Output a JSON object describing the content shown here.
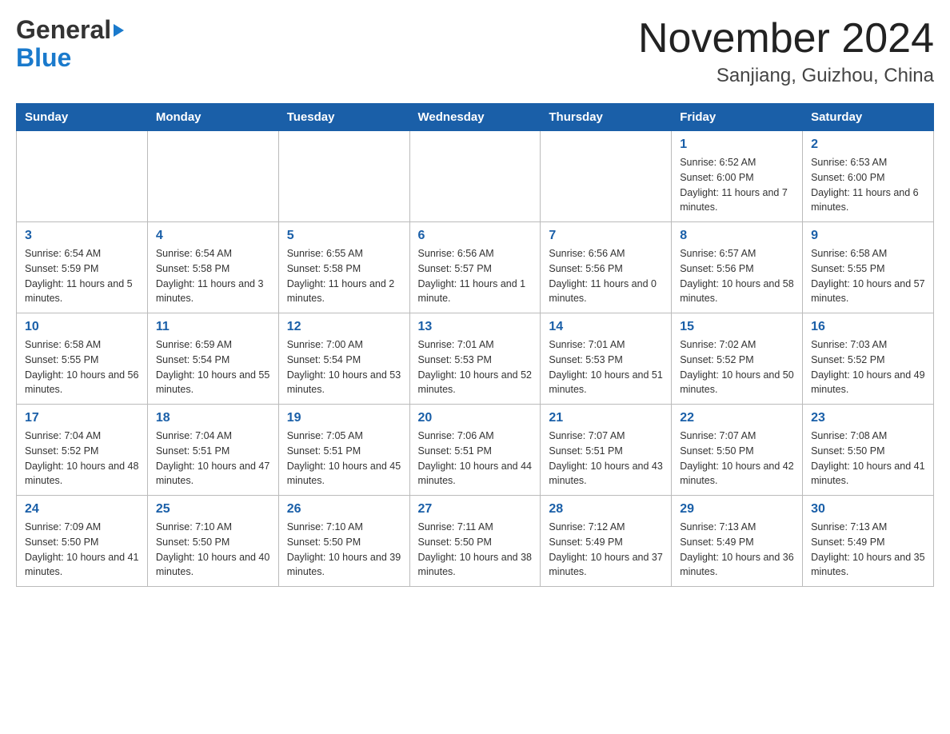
{
  "logo": {
    "general_text": "General",
    "blue_text": "Blue"
  },
  "header": {
    "month_year": "November 2024",
    "location": "Sanjiang, Guizhou, China"
  },
  "days_of_week": [
    "Sunday",
    "Monday",
    "Tuesday",
    "Wednesday",
    "Thursday",
    "Friday",
    "Saturday"
  ],
  "weeks": [
    [
      {
        "day": "",
        "info": ""
      },
      {
        "day": "",
        "info": ""
      },
      {
        "day": "",
        "info": ""
      },
      {
        "day": "",
        "info": ""
      },
      {
        "day": "",
        "info": ""
      },
      {
        "day": "1",
        "info": "Sunrise: 6:52 AM\nSunset: 6:00 PM\nDaylight: 11 hours and 7 minutes."
      },
      {
        "day": "2",
        "info": "Sunrise: 6:53 AM\nSunset: 6:00 PM\nDaylight: 11 hours and 6 minutes."
      }
    ],
    [
      {
        "day": "3",
        "info": "Sunrise: 6:54 AM\nSunset: 5:59 PM\nDaylight: 11 hours and 5 minutes."
      },
      {
        "day": "4",
        "info": "Sunrise: 6:54 AM\nSunset: 5:58 PM\nDaylight: 11 hours and 3 minutes."
      },
      {
        "day": "5",
        "info": "Sunrise: 6:55 AM\nSunset: 5:58 PM\nDaylight: 11 hours and 2 minutes."
      },
      {
        "day": "6",
        "info": "Sunrise: 6:56 AM\nSunset: 5:57 PM\nDaylight: 11 hours and 1 minute."
      },
      {
        "day": "7",
        "info": "Sunrise: 6:56 AM\nSunset: 5:56 PM\nDaylight: 11 hours and 0 minutes."
      },
      {
        "day": "8",
        "info": "Sunrise: 6:57 AM\nSunset: 5:56 PM\nDaylight: 10 hours and 58 minutes."
      },
      {
        "day": "9",
        "info": "Sunrise: 6:58 AM\nSunset: 5:55 PM\nDaylight: 10 hours and 57 minutes."
      }
    ],
    [
      {
        "day": "10",
        "info": "Sunrise: 6:58 AM\nSunset: 5:55 PM\nDaylight: 10 hours and 56 minutes."
      },
      {
        "day": "11",
        "info": "Sunrise: 6:59 AM\nSunset: 5:54 PM\nDaylight: 10 hours and 55 minutes."
      },
      {
        "day": "12",
        "info": "Sunrise: 7:00 AM\nSunset: 5:54 PM\nDaylight: 10 hours and 53 minutes."
      },
      {
        "day": "13",
        "info": "Sunrise: 7:01 AM\nSunset: 5:53 PM\nDaylight: 10 hours and 52 minutes."
      },
      {
        "day": "14",
        "info": "Sunrise: 7:01 AM\nSunset: 5:53 PM\nDaylight: 10 hours and 51 minutes."
      },
      {
        "day": "15",
        "info": "Sunrise: 7:02 AM\nSunset: 5:52 PM\nDaylight: 10 hours and 50 minutes."
      },
      {
        "day": "16",
        "info": "Sunrise: 7:03 AM\nSunset: 5:52 PM\nDaylight: 10 hours and 49 minutes."
      }
    ],
    [
      {
        "day": "17",
        "info": "Sunrise: 7:04 AM\nSunset: 5:52 PM\nDaylight: 10 hours and 48 minutes."
      },
      {
        "day": "18",
        "info": "Sunrise: 7:04 AM\nSunset: 5:51 PM\nDaylight: 10 hours and 47 minutes."
      },
      {
        "day": "19",
        "info": "Sunrise: 7:05 AM\nSunset: 5:51 PM\nDaylight: 10 hours and 45 minutes."
      },
      {
        "day": "20",
        "info": "Sunrise: 7:06 AM\nSunset: 5:51 PM\nDaylight: 10 hours and 44 minutes."
      },
      {
        "day": "21",
        "info": "Sunrise: 7:07 AM\nSunset: 5:51 PM\nDaylight: 10 hours and 43 minutes."
      },
      {
        "day": "22",
        "info": "Sunrise: 7:07 AM\nSunset: 5:50 PM\nDaylight: 10 hours and 42 minutes."
      },
      {
        "day": "23",
        "info": "Sunrise: 7:08 AM\nSunset: 5:50 PM\nDaylight: 10 hours and 41 minutes."
      }
    ],
    [
      {
        "day": "24",
        "info": "Sunrise: 7:09 AM\nSunset: 5:50 PM\nDaylight: 10 hours and 41 minutes."
      },
      {
        "day": "25",
        "info": "Sunrise: 7:10 AM\nSunset: 5:50 PM\nDaylight: 10 hours and 40 minutes."
      },
      {
        "day": "26",
        "info": "Sunrise: 7:10 AM\nSunset: 5:50 PM\nDaylight: 10 hours and 39 minutes."
      },
      {
        "day": "27",
        "info": "Sunrise: 7:11 AM\nSunset: 5:50 PM\nDaylight: 10 hours and 38 minutes."
      },
      {
        "day": "28",
        "info": "Sunrise: 7:12 AM\nSunset: 5:49 PM\nDaylight: 10 hours and 37 minutes."
      },
      {
        "day": "29",
        "info": "Sunrise: 7:13 AM\nSunset: 5:49 PM\nDaylight: 10 hours and 36 minutes."
      },
      {
        "day": "30",
        "info": "Sunrise: 7:13 AM\nSunset: 5:49 PM\nDaylight: 10 hours and 35 minutes."
      }
    ]
  ]
}
